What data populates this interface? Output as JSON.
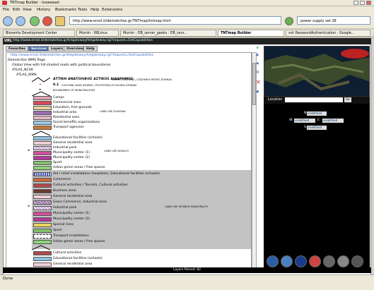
{
  "window": {
    "title": "TNTmap Builder - Iceweasel"
  },
  "menu": [
    "File",
    "Edit",
    "View",
    "History",
    "Bookmarks",
    "Tools",
    "Help",
    "Extensions"
  ],
  "nav": {
    "url": "http://www.ernst.it/demokritos.gr/TNTmap/tntmap.html",
    "search": "power supply set 28"
  },
  "browser_tabs": [
    {
      "label": "Bioventa Development Center"
    },
    {
      "label": "Mumin : 88Linux"
    },
    {
      "label": "Mumin : DB_server_geeks : DB_serv..."
    },
    {
      "label": "TNTmap Builder"
    },
    {
      "label": "ssh PasswordAuthentication - Google..."
    }
  ],
  "app": {
    "logo": "URL",
    "wms_url": "http://www.ernst.it/demokritos.gr/tntgateway/tntgateway.cgi?request=GetCapabilities"
  },
  "left_tabs": [
    "Favorites",
    "Services",
    "Layers",
    "Overview",
    "Help"
  ],
  "tree": {
    "url": "http://www.ernst.it/demokritos.gr/tntgateway/tntgateway.cgi?request=GetCapabilities",
    "page_title": "Demokritos WMS Page",
    "global": "Global View with hill-shaded roads with political boundaries",
    "atlas": "ATLAS_NCSR",
    "atlas_wms": "ATLAS_WMS",
    "items_top": [
      {
        "title": "ΑΤΤΙΚΗ ΑΝΑΤΟΛΙΚΟΣ ΑΣΤΙΚΟΣ ΔΙΑΔΡΟΜΟΣ",
        "sub": "METRO STATIONS / STATHMOI METRO ATHINAS"
      },
      {
        "title": "0.1",
        "sub": "CULTURAL DATA ATHENS / POLITISTIKA STOICHEIA ATHINAS"
      },
      {
        "title": "",
        "sub": "BOUNDARIES OF MUNICIPALITIES"
      }
    ],
    "group1": [
      "Camps",
      "Commercial area",
      "Education, free grounds",
      "Industrial area",
      "Residential area",
      "Social benefits organisations",
      "Transport agencies"
    ],
    "note1": "LAND USE ELASONA",
    "group2": [
      "Educational facilities (schools)",
      "General residential area",
      "Industrial park",
      "Municipality center (1)",
      "Municipality center (2)",
      "Sport",
      "Urban green areas / free spaces"
    ],
    "note2": "LAND USE AIGALEO",
    "group3": [
      "Aid / relief installations (hospitals), Educational facilities (schools)",
      "Commerce",
      "Cultural activities / Tourism, Cultural activities",
      "Business zone",
      "General residential area",
      "Gross Commerce, Industrial zone",
      "Industrial park",
      "Municipality center (1)",
      "Municipality center (2)",
      "Special Uses",
      "Sport",
      "Transport installations",
      "Urban green areas / free spaces"
    ],
    "note3": "LAND USE ATHINOS MUNICIPALITY",
    "group4": [
      "Cultural activities",
      "Educational facilities (schools)",
      "General residential area"
    ]
  },
  "right_panel": {
    "location_label": "Location",
    "go": "Go",
    "coords": [
      {
        "label": "N:",
        "value": "undefined"
      },
      {
        "label": "W:",
        "value": "undefined"
      },
      {
        "label": "S:",
        "value": "undefined"
      },
      {
        "label": "E:",
        "value": "undefined"
      }
    ],
    "status": "Layers Parsed: 82"
  },
  "status_bar": {
    "text": "Done"
  },
  "colors": {
    "camps": "#d9a3b0",
    "commercial": "#d84a5a",
    "education": "#e6d29c",
    "industrial": "#a06bb5",
    "residential": "#e8b6c6",
    "social": "#9ac9e8",
    "transport": "#c47a3a",
    "edu2": "#8cc0e0",
    "genres": "#f2cfd8",
    "indpark": "#c9a6d6",
    "muni1": "#d44f9a",
    "muni2": "#b7379c",
    "sport": "#7fc06c",
    "green": "#8ed37a",
    "aid": "#4b58b8",
    "commerce": "#c96b3a",
    "cultural": "#b24a4a",
    "business": "#6a3a2a",
    "special": "#e7d65b"
  }
}
